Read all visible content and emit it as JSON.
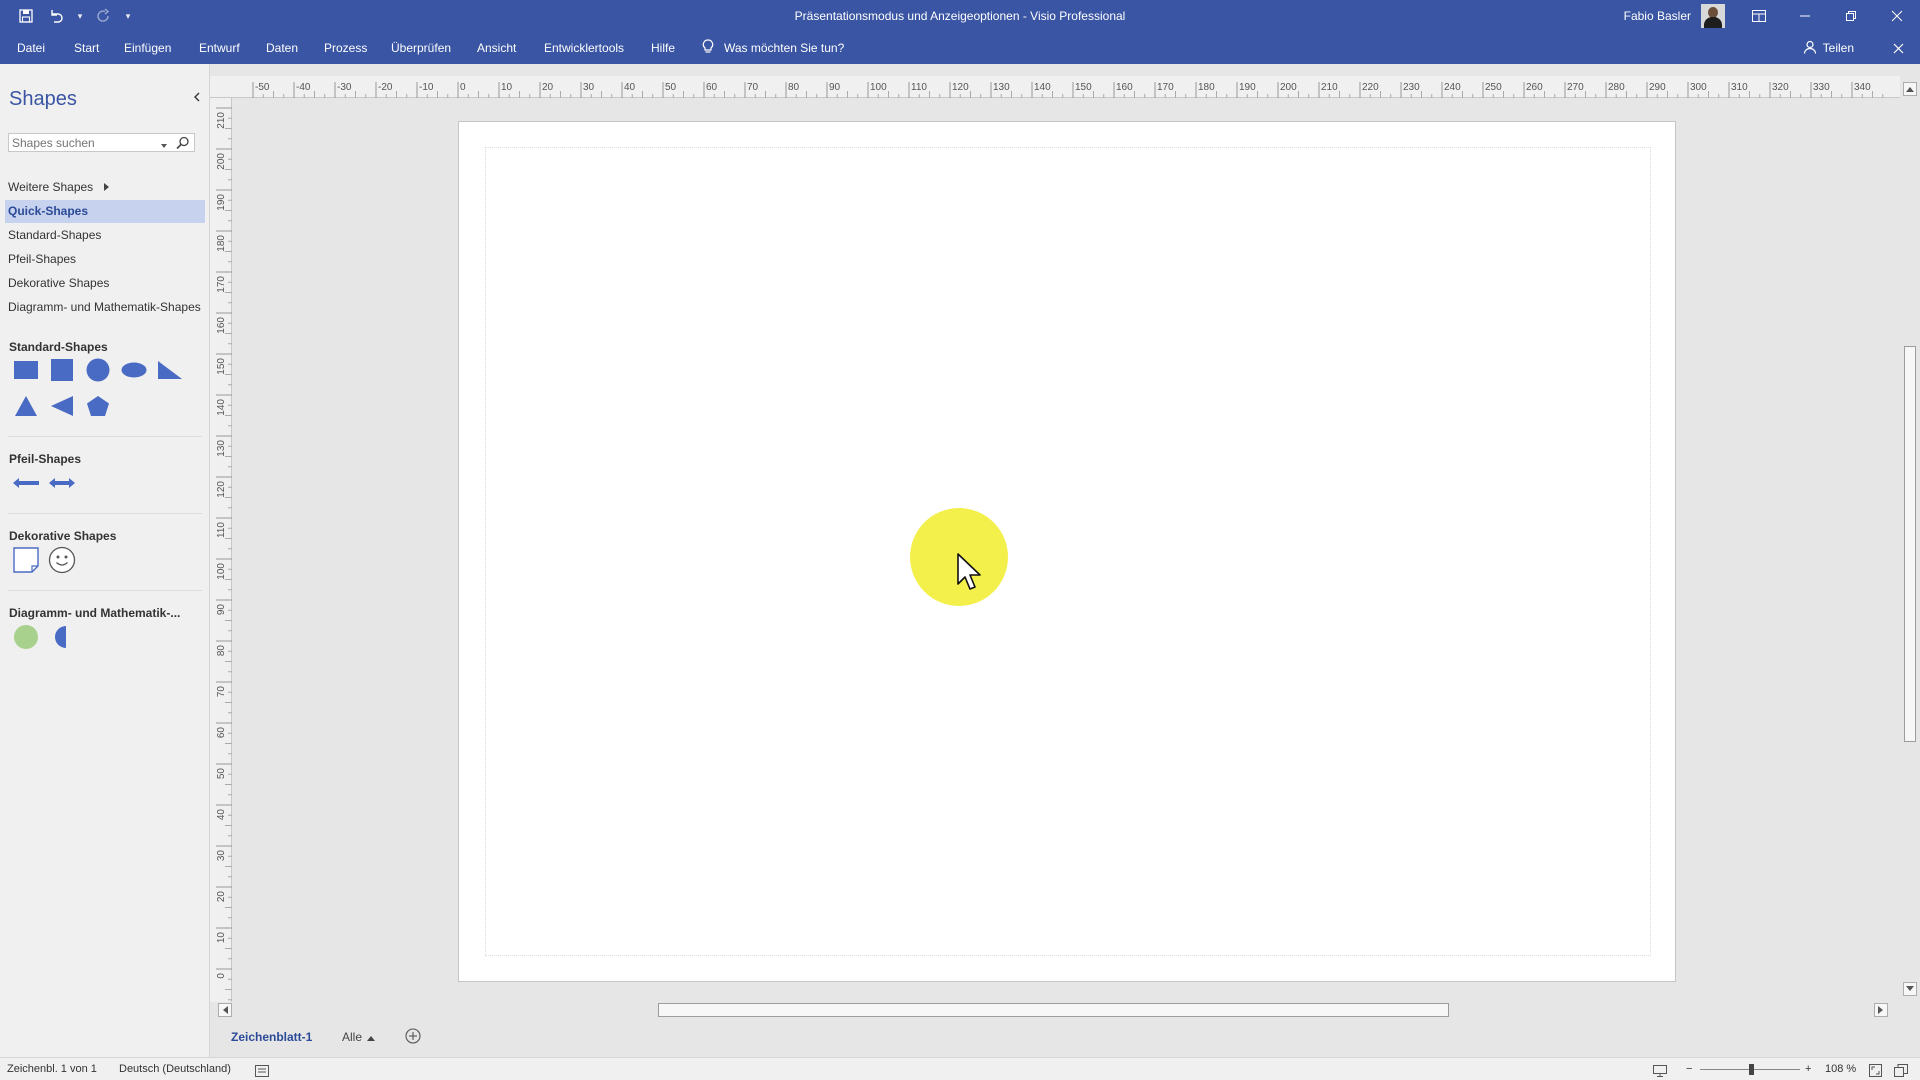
{
  "window": {
    "title": "Präsentationsmodus und Anzeigeoptionen - Visio Professional",
    "user_name": "Fabio Basler"
  },
  "menu": {
    "items": [
      "Datei",
      "Start",
      "Einfügen",
      "Entwurf",
      "Daten",
      "Prozess",
      "Überprüfen",
      "Ansicht",
      "Entwicklertools",
      "Hilfe"
    ],
    "tell_me": "Was möchten Sie tun?",
    "share": "Teilen"
  },
  "shapes_panel": {
    "title": "Shapes",
    "search_placeholder": "Shapes suchen",
    "more_shapes": "Weitere Shapes",
    "nav_items": [
      "Quick-Shapes",
      "Standard-Shapes",
      "Pfeil-Shapes",
      "Dekorative Shapes",
      "Diagramm- und Mathematik-Shapes"
    ],
    "active_nav": "Quick-Shapes",
    "stencils": {
      "standard": "Standard-Shapes",
      "arrow": "Pfeil-Shapes",
      "decorative": "Dekorative Shapes",
      "math": "Diagramm- und Mathematik-..."
    }
  },
  "ruler": {
    "h_labels": [
      "-50",
      "-40",
      "-30",
      "-20",
      "-10",
      "0",
      "10",
      "20",
      "30",
      "40",
      "50",
      "60",
      "70",
      "80",
      "90",
      "100",
      "110",
      "120",
      "130",
      "140",
      "150",
      "160",
      "170",
      "180",
      "190",
      "200",
      "210",
      "220",
      "230",
      "240",
      "250",
      "260",
      "270",
      "280",
      "290",
      "300",
      "310",
      "320",
      "330",
      "340"
    ],
    "v_labels": [
      "210",
      "200",
      "190",
      "180",
      "170",
      "160",
      "150",
      "140",
      "130",
      "120",
      "110",
      "100",
      "90",
      "80",
      "70",
      "60",
      "50",
      "40",
      "30",
      "20",
      "10",
      "0"
    ]
  },
  "sheets": {
    "active": "Zeichenblatt-1",
    "all": "Alle"
  },
  "status": {
    "page": "Zeichenbl. 1 von 1",
    "language": "Deutsch (Deutschland)",
    "zoom": "108 %"
  },
  "colors": {
    "accent": "#3955a3",
    "shape_fill": "#4a6bc4",
    "math_circle": "#a9d18e",
    "spotlight": "#f2ef3c"
  }
}
